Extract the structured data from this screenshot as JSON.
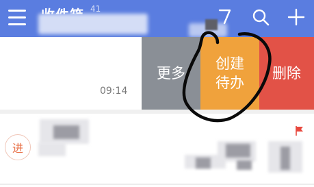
{
  "colors": {
    "accent": "#5a7de0",
    "more": "#8a8f96",
    "todo": "#f0a23c",
    "delete": "#e25247"
  },
  "header": {
    "title": "收件箱",
    "count": "41",
    "icons": [
      "menu-icon",
      "compose-icon",
      "search-icon",
      "add-icon"
    ]
  },
  "message": {
    "time": "09:14"
  },
  "swipe_actions": {
    "more": "更多",
    "todo_line1": "创建",
    "todo_line2": "待办",
    "delete": "删除"
  },
  "second_item": {
    "avatar_text": "进",
    "flag_icon": "red-flag-icon"
  }
}
